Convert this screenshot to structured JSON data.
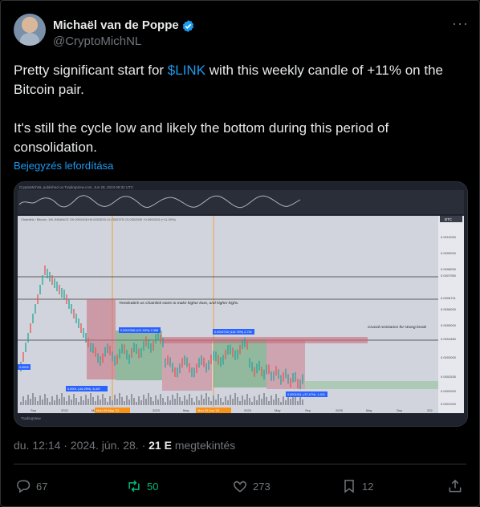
{
  "author": {
    "name": "Michaël van de Poppe",
    "handle": "@CryptoMichNL",
    "verified": true,
    "accent": "#1d9bf0"
  },
  "post": {
    "line1_pre": "Pretty significant start for ",
    "cashtag": "$LINK",
    "line1_post": " with this weekly candle of +11% on the Bitcoin pair.",
    "line2": "It's still the cycle low and likely the bottom during this period of consolidation.",
    "translate_label": "Bejegyzés lefordítása"
  },
  "chart": {
    "header": "CryptoMichNL published on TradingView.com, Jun 28, 2024 09:32 UTC",
    "symbol": "Chainlink / Bitcoin, 1W, BINANCE  O0.0002408  H0.0002533  L0.0002375  C0.0002535  +0.0000315 (+11.39%)",
    "pair_label": "BTC",
    "price_labels": [
      "0.0010000",
      "0.0009000",
      "0.0008000",
      "0.0007950",
      "0.0006721",
      "0.0006000",
      "0.0005000",
      "0.0004480",
      "0.0003000",
      "0.0002535",
      "0.0002000",
      "0.0001000"
    ],
    "annotation_1": "Trendswitch as Chainlink starts to make higher lows, and higher highs.",
    "annotation_2": "Crucial resistance for strong break",
    "box_label_1": "0.0002368 (121.93%) 2,368",
    "box_label_2": "0.0002702 (115.76%) 2,702",
    "box_label_3": "0.0001011 (-37.47%) -1,011",
    "box_label_4": "0.0001 (-64.25%) -6,447",
    "left_label": "0.0003",
    "x_labels": [
      "Sep",
      "2022",
      "May",
      "Sep",
      "2023",
      "May",
      "Sep",
      "2024",
      "May",
      "Sep",
      "2025",
      "May",
      "Sep",
      "202"
    ],
    "date_badges": [
      "Mon 09 May '22",
      "Mon 19 Jun '23"
    ],
    "watermark": "TradingView"
  },
  "meta": {
    "time": "du. 12:14 · 2024. jún. 28. · ",
    "views": "21 E",
    "views_suffix": " megtekintés"
  },
  "actions": {
    "replies": "67",
    "reposts": "50",
    "likes": "273",
    "bookmarks": "12"
  }
}
